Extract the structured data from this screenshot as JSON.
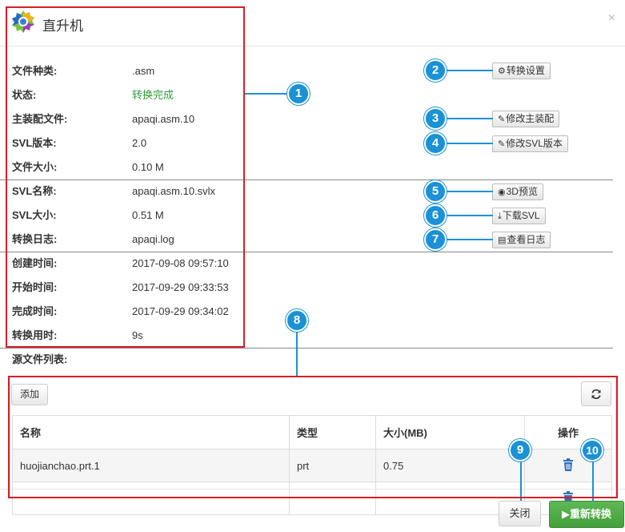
{
  "dialog": {
    "title": "直升机",
    "close_glyph": "×",
    "logo_icon": "gear-logo-icon"
  },
  "info": [
    {
      "label": "文件种类:",
      "value": ".asm"
    },
    {
      "label": "状态:",
      "value": "转换完成",
      "color": "#2e9e3a"
    },
    {
      "label": "主装配文件:",
      "value": "apaqi.asm.10"
    },
    {
      "label": "SVL版本:",
      "value": "2.0"
    },
    {
      "label": "文件大小:",
      "value": "0.10 M"
    },
    {
      "label": "SVL名称:",
      "value": "apaqi.asm.10.svlx"
    },
    {
      "label": "SVL大小:",
      "value": "0.51 M"
    },
    {
      "label": "转换日志:",
      "value": "apaqi.log"
    },
    {
      "label": "创建时间:",
      "value": "2017-09-08 09:57:10"
    },
    {
      "label": "开始时间:",
      "value": "2017-09-29 09:33:53"
    },
    {
      "label": "完成时间:",
      "value": "2017-09-29 09:34:02"
    },
    {
      "label": "转换用时:",
      "value": "9s"
    }
  ],
  "side_buttons": {
    "convert_settings": {
      "label": "转换设置",
      "icon": "gear-icon"
    },
    "modify_main_asm": {
      "label": "修改主装配",
      "icon": "edit-icon"
    },
    "modify_svl_version": {
      "label": "修改SVL版本",
      "icon": "edit-icon"
    },
    "preview_3d": {
      "label": "3D预览",
      "icon": "eye-icon"
    },
    "download_svl": {
      "label": "下载SVL",
      "icon": "download-icon"
    },
    "view_log": {
      "label": "查看日志",
      "icon": "document-icon"
    }
  },
  "source_list": {
    "label": "源文件列表:",
    "add_label": "添加",
    "refresh_icon": "refresh-icon",
    "columns": [
      "名称",
      "类型",
      "大小(MB)",
      "操作"
    ],
    "rows": [
      {
        "name": "huojianchao.prt.1",
        "type": "prt",
        "size": "0.75",
        "action_icon": "trash-icon"
      },
      {
        "name": "",
        "type": "",
        "size": "",
        "action_icon": "trash-icon"
      }
    ]
  },
  "footer": {
    "close_label": "关闭",
    "reconvert_label": "重新转换",
    "reconvert_color": "#4cae44"
  },
  "annotations": {
    "color": "#1b91d6",
    "box_color": "#d81e28",
    "badges": [
      "1",
      "2",
      "3",
      "4",
      "5",
      "6",
      "7",
      "8",
      "9",
      "10"
    ]
  }
}
